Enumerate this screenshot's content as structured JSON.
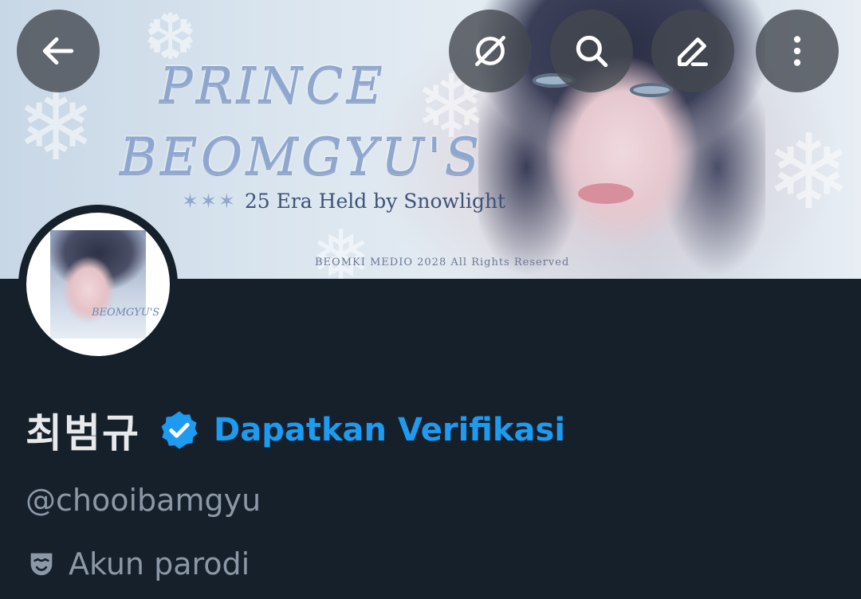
{
  "banner": {
    "title_line1": "PRINCE",
    "title_line2": "BEOMGYU'S",
    "stars": "✶✶✶",
    "subtitle": "25 Era Held by Snowlight",
    "copyright": "BEOMKI MEDIO 2028 All Rights Reserved"
  },
  "avatar": {
    "art_text": "BEOMGYU'S"
  },
  "toolbar": {
    "icons": [
      "arrow-left-icon",
      "grok-icon",
      "search-icon",
      "edit-icon",
      "more-vertical-icon"
    ]
  },
  "profile": {
    "display_name": "최범규",
    "verify_cta": "Dapatkan Verifikasi",
    "handle": "@chooibamgyu",
    "parody_label": "Akun parodi"
  },
  "colors": {
    "background": "#15202b",
    "accent": "#1d9bf0",
    "primary_text": "#e7e9ea",
    "secondary_text": "#8b98a5",
    "button_bg": "#444850"
  }
}
